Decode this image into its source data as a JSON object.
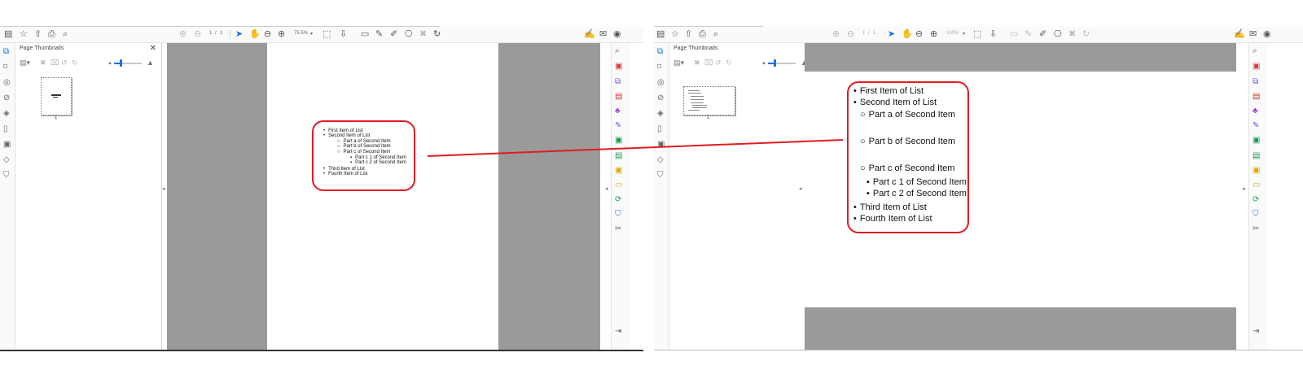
{
  "left_view": {
    "toolbar": {
      "page_current": "1",
      "page_sep": "/",
      "page_total": "1",
      "zoom": "75.5%"
    },
    "thumbnails_panel": {
      "title": "Page Thumbnails",
      "page_number": "1"
    },
    "list": {
      "items": [
        {
          "bullet": "•",
          "text": "First Item of List"
        },
        {
          "bullet": "•",
          "text": "Second Item of List"
        },
        {
          "bullet": "○",
          "text": "Part a of Second Item"
        },
        {
          "bullet": "○",
          "text": "Part b of Second Item"
        },
        {
          "bullet": "○",
          "text": "Part c of Second Item"
        },
        {
          "bullet": "▪",
          "text": "Part c 1 of Second Item"
        },
        {
          "bullet": "▪",
          "text": "Part c 2 of Second Item"
        },
        {
          "bullet": "•",
          "text": "Third Item of List"
        },
        {
          "bullet": "•",
          "text": "Fourth Item of List"
        }
      ]
    }
  },
  "right_view": {
    "toolbar": {
      "page_current": "1",
      "page_sep": "/",
      "page_total": "1",
      "zoom": "100%"
    },
    "thumbnails_panel": {
      "title": "Page Thumbnails",
      "page_number": "1"
    },
    "list": {
      "items": [
        {
          "bullet": "•",
          "text": "First Item of List"
        },
        {
          "bullet": "•",
          "text": "Second Item of List"
        },
        {
          "bullet": "○",
          "text": "Part a of Second Item"
        },
        {
          "bullet": "○",
          "text": "Part b of Second Item"
        },
        {
          "bullet": "○",
          "text": "Part c of Second Item"
        },
        {
          "bullet": "▪",
          "text": "Part c 1 of Second Item"
        },
        {
          "bullet": "▪",
          "text": "Part c 2 of Second Item"
        },
        {
          "bullet": "•",
          "text": "Third Item of List"
        },
        {
          "bullet": "•",
          "text": "Fourth Item of List"
        }
      ]
    }
  },
  "icons": {
    "save": "▤",
    "star": "☆",
    "upload": "⇧",
    "print": "⎙",
    "search": "⌕",
    "page_up": "⊕",
    "page_down": "⊖",
    "select": "➤",
    "hand": "✋",
    "zoom_out": "⊖",
    "zoom_in": "⊕",
    "fit": "⬚",
    "comment": "▭",
    "pen": "✎",
    "highlight": "✐",
    "stamp": "⎔",
    "trash": "🗑",
    "rotate": "↻",
    "sign": "✍",
    "mail": "✉",
    "account": "◉",
    "close": "✕",
    "pages": "⧉",
    "bookmark": "⌑",
    "layers": "◈",
    "attach": "⊘",
    "tag": "◇",
    "shield": "⛉"
  },
  "colors": {
    "accent": "#1473e6",
    "callout_border": "#e01b24",
    "canvas_gray": "#9a9a9a"
  }
}
